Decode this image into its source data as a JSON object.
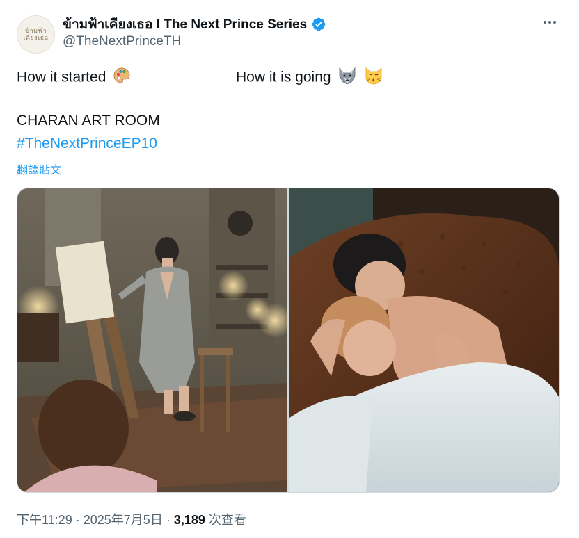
{
  "author": {
    "display_name": "ข้ามฟ้าเคียงเธอ I The Next Prince Series",
    "handle": "@TheNextPrinceTH",
    "verified": true,
    "avatar_logo_line1": "ข้ามฟ้า",
    "avatar_logo_line2": "เคียงเธอ"
  },
  "tweet": {
    "line1_left": "How it started",
    "line1_left_emoji": "palette-emoji",
    "line1_right": "How it is going",
    "line1_right_emojis": [
      "wolf-emoji",
      "kissing-cat-emoji"
    ],
    "line2": "CHARAN ART ROOM",
    "hashtag": "#TheNextPrinceEP10",
    "translate_label": "翻譯貼文"
  },
  "meta": {
    "time": "下午11:29",
    "separator": "·",
    "date": "2025年7月5日",
    "views_count": "3,189",
    "views_label": "次查看"
  },
  "colors": {
    "link": "#1d9bf0",
    "verified": "#1d9bf0",
    "secondary_text": "#536471"
  },
  "icons": {
    "verified": "verified-badge-icon",
    "more": "more-dots-icon"
  }
}
